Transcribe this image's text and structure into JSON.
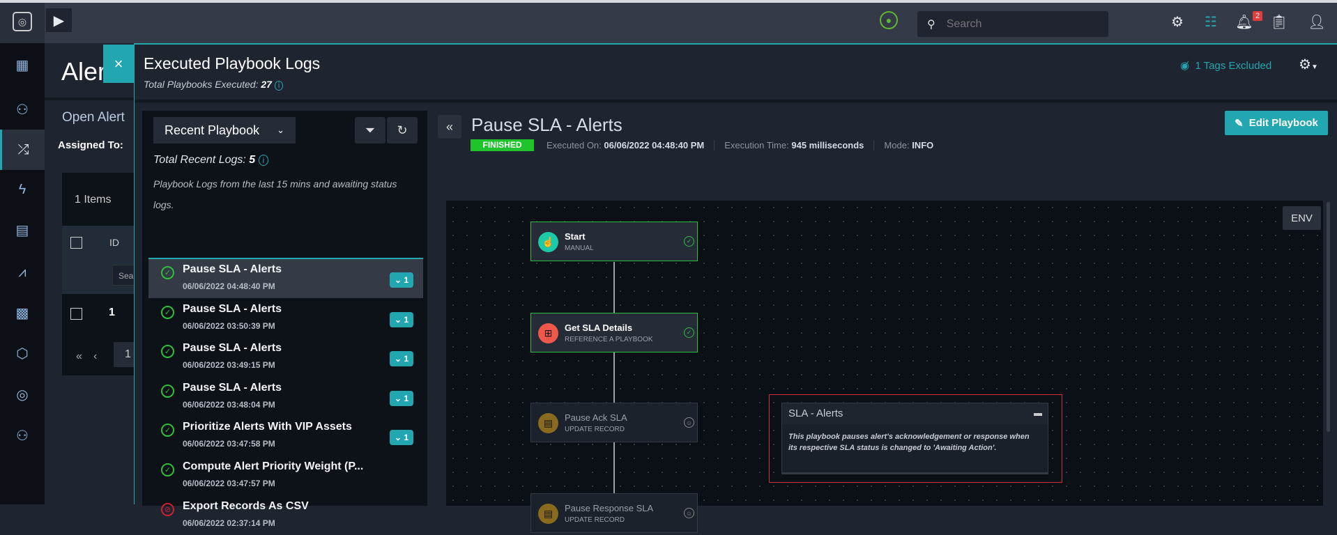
{
  "topbar": {
    "search_placeholder": "Search",
    "notification_count": "2"
  },
  "background_page": {
    "title": "Aler",
    "subtitle": "Open Alert",
    "assigned_label": "Assigned To:",
    "items_count": "1 Items",
    "id_header": "ID",
    "search_stub": "Sea",
    "row_id": "1",
    "page": "1"
  },
  "panel": {
    "title": "Executed Playbook Logs",
    "total_label": "Total Playbooks Executed:",
    "total_value": "27",
    "tags_excluded": "1 Tags Excluded"
  },
  "list": {
    "select_value": "Recent Playbook",
    "recent_label": "Total Recent Logs:",
    "recent_value": "5",
    "description": "Playbook Logs from the last 15 mins and awaiting status logs.",
    "items": [
      {
        "name": "Pause SLA - Alerts",
        "date": "06/06/2022 04:48:40 PM",
        "status": "success",
        "badge": "1"
      },
      {
        "name": "Pause SLA - Alerts",
        "date": "06/06/2022 03:50:39 PM",
        "status": "success",
        "badge": "1"
      },
      {
        "name": "Pause SLA - Alerts",
        "date": "06/06/2022 03:49:15 PM",
        "status": "success",
        "badge": "1"
      },
      {
        "name": "Pause SLA - Alerts",
        "date": "06/06/2022 03:48:04 PM",
        "status": "success",
        "badge": "1"
      },
      {
        "name": "Prioritize Alerts With VIP Assets",
        "date": "06/06/2022 03:47:58 PM",
        "status": "success",
        "badge": "1"
      },
      {
        "name": "Compute Alert Priority Weight (P...",
        "date": "06/06/2022 03:47:57 PM",
        "status": "success"
      },
      {
        "name": "Export Records As CSV",
        "date": "06/06/2022 02:37:14 PM",
        "status": "failed"
      }
    ]
  },
  "detail": {
    "title": "Pause SLA - Alerts",
    "status": "FINISHED",
    "executed_label": "Executed On:",
    "executed_value": "06/06/2022 04:48:40 PM",
    "time_label": "Execution Time:",
    "time_value": "945 milliseconds",
    "mode_label": "Mode:",
    "mode_value": "INFO",
    "edit_label": "Edit Playbook",
    "env_label": "ENV",
    "nodes": [
      {
        "title": "Start",
        "subtitle": "MANUAL"
      },
      {
        "title": "Get SLA Details",
        "subtitle": "REFERENCE A PLAYBOOK"
      },
      {
        "title": "Pause Ack SLA",
        "subtitle": "UPDATE RECORD"
      },
      {
        "title": "Pause Response SLA",
        "subtitle": "UPDATE RECORD"
      }
    ],
    "note": {
      "title": "SLA - Alerts",
      "text": "This playbook pauses alert's acknowledgement or response when its respective SLA status is changed to 'Awaiting Action'."
    }
  },
  "colors": {
    "accent": "#22a7b1",
    "success": "#2fbf3a",
    "failed": "#d0202e"
  }
}
